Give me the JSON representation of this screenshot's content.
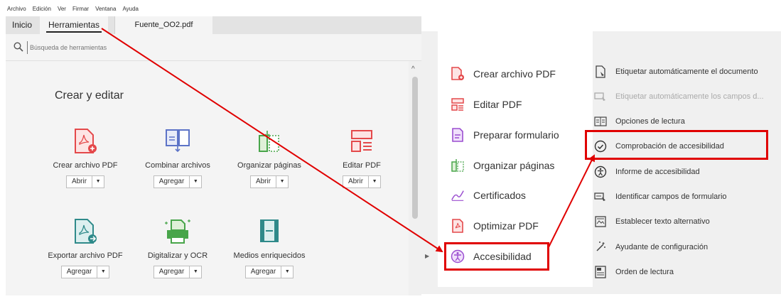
{
  "menubar": [
    "Archivo",
    "Edición",
    "Ver",
    "Firmar",
    "Ventana",
    "Ayuda"
  ],
  "tabs": {
    "home": "Inicio",
    "tools": "Herramientas",
    "file": "Fuente_OO2.pdf"
  },
  "search": {
    "placeholder": "Búsqueda de herramientas"
  },
  "section_title": "Crear y editar",
  "tools": [
    {
      "label": "Crear archivo PDF",
      "button": "Abrir",
      "icon": "create-pdf-icon"
    },
    {
      "label": "Combinar archivos",
      "button": "Agregar",
      "icon": "combine-files-icon"
    },
    {
      "label": "Organizar páginas",
      "button": "Abrir",
      "icon": "organize-pages-icon"
    },
    {
      "label": "Editar PDF",
      "button": "Abrir",
      "icon": "edit-pdf-icon"
    },
    {
      "label": "Exportar archivo PDF",
      "button": "Agregar",
      "icon": "export-pdf-icon"
    },
    {
      "label": "Digitalizar y OCR",
      "button": "Agregar",
      "icon": "scan-ocr-icon"
    },
    {
      "label": "Medios enriquecidos",
      "button": "Agregar",
      "icon": "rich-media-icon"
    }
  ],
  "right_panel": [
    {
      "label": "Crear archivo PDF",
      "icon": "create-pdf-icon"
    },
    {
      "label": "Editar PDF",
      "icon": "edit-pdf-icon"
    },
    {
      "label": "Preparar formulario",
      "icon": "prepare-form-icon"
    },
    {
      "label": "Organizar páginas",
      "icon": "organize-pages-icon"
    },
    {
      "label": "Certificados",
      "icon": "certificates-icon"
    },
    {
      "label": "Optimizar PDF",
      "icon": "optimize-pdf-icon"
    },
    {
      "label": "Accesibilidad",
      "icon": "accessibility-icon"
    }
  ],
  "accessibility_tools": [
    {
      "label": "Etiquetar automáticamente el documento",
      "icon": "autotag-document-icon",
      "enabled": true
    },
    {
      "label": "Etiquetar automáticamente los campos d...",
      "icon": "autotag-fields-icon",
      "enabled": false
    },
    {
      "label": "Opciones de lectura",
      "icon": "reading-options-icon",
      "enabled": true
    },
    {
      "label": "Comprobación de accesibilidad",
      "icon": "check-circle-icon",
      "enabled": true
    },
    {
      "label": "Informe de accesibilidad",
      "icon": "accessibility-report-icon",
      "enabled": true
    },
    {
      "label": "Identificar campos de formulario",
      "icon": "identify-fields-icon",
      "enabled": true
    },
    {
      "label": "Establecer texto alternativo",
      "icon": "alt-text-icon",
      "enabled": true
    },
    {
      "label": "Ayudante de configuración",
      "icon": "setup-assistant-icon",
      "enabled": true
    },
    {
      "label": "Orden de lectura",
      "icon": "reading-order-icon",
      "enabled": true
    }
  ],
  "colors": {
    "highlight": "#e00000",
    "pdf_red": "#e4494b",
    "blue": "#5c73c7",
    "green": "#48a54a",
    "teal": "#2f8a8a",
    "purple": "#9b4ed0"
  }
}
